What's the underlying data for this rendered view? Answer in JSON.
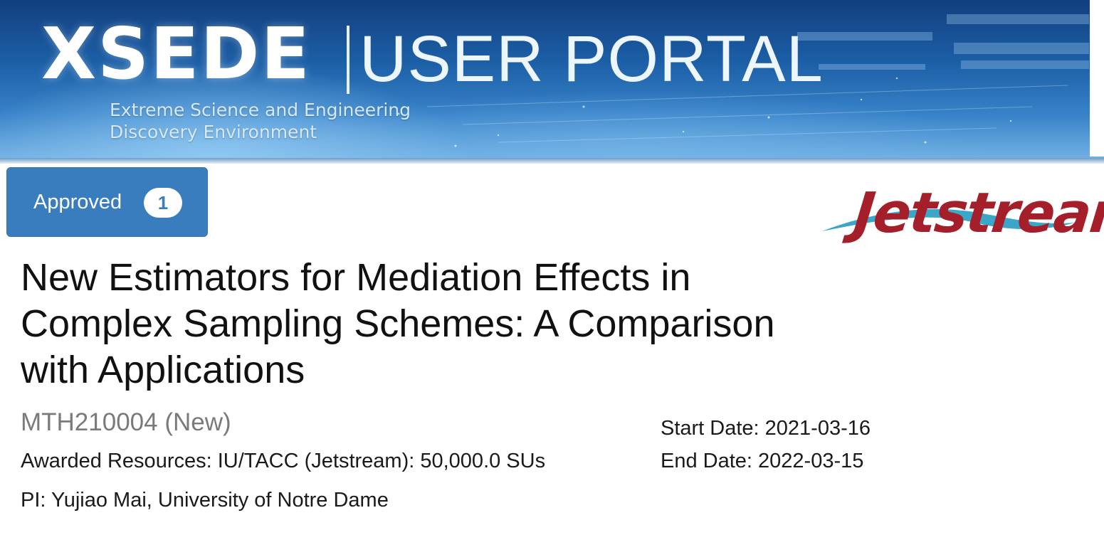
{
  "header": {
    "logo_primary": "XSEDE",
    "logo_secondary": "USER PORTAL",
    "tagline_line1": "Extreme Science and Engineering",
    "tagline_line2": "Discovery Environment"
  },
  "status": {
    "label": "Approved",
    "count": "1",
    "color": "#3a7dbf"
  },
  "resource_logo": {
    "text": "Jetstream",
    "text_color": "#a51f2a",
    "swoosh_color": "#3aa7c8"
  },
  "project": {
    "title": "New Estimators for Mediation Effects in Complex Sampling Schemes: A Comparison with Applications",
    "code": "MTH210004 (New)",
    "awarded_resources": "Awarded Resources: IU/TACC (Jetstream): 50,000.0 SUs",
    "pi": "PI: Yujiao Mai, University of Notre Dame",
    "start_date": "Start Date: 2021-03-16",
    "end_date": "End Date: 2022-03-15"
  }
}
